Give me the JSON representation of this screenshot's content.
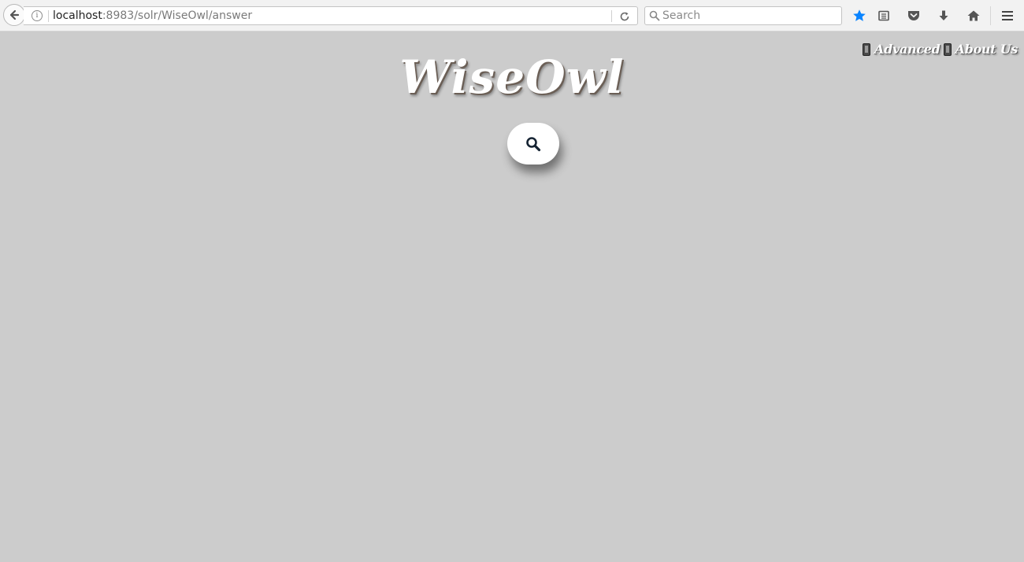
{
  "browser": {
    "url_host": "localhost",
    "url_rest": ":8983/solr/WiseOwl/answer",
    "search_placeholder": "Search",
    "accent_color": "#0a84ff",
    "icons": [
      "back-icon",
      "info-icon",
      "reload-icon",
      "search-icon",
      "bookmark-star-icon",
      "reading-list-icon",
      "pocket-icon",
      "download-icon",
      "home-icon",
      "menu-icon"
    ]
  },
  "page": {
    "background_color": "#cccccc",
    "logo_text": "WiseOwl",
    "nav": {
      "advanced_label": "Advanced",
      "about_label": "About Us",
      "icon": "phone-icon"
    },
    "search_button_icon": "search-icon"
  }
}
